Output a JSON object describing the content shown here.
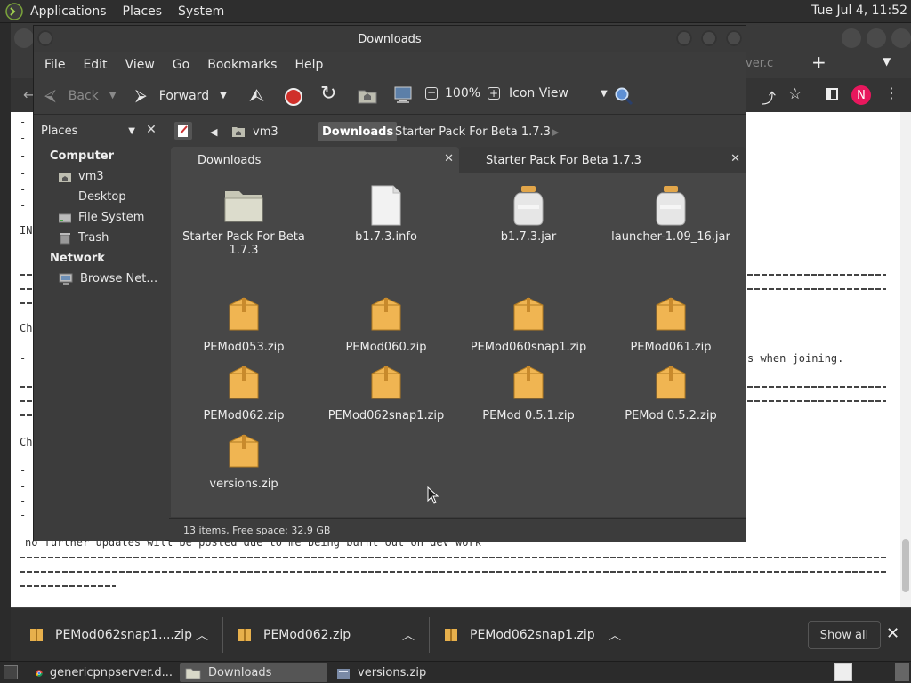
{
  "top_panel": {
    "menus": [
      "Applications",
      "Places",
      "System"
    ],
    "clock": "Tue Jul  4, 11:52"
  },
  "browser": {
    "background_lines": [
      "no further updates will be posted due to me being burnt out on dev work",
      "s when joining."
    ],
    "background_fragments": [
      "IN",
      "Ch",
      "Ch",
      "ver.c"
    ],
    "avatar_letter": "N",
    "accent": "#e8175d"
  },
  "downloads_bar": {
    "items": [
      "PEMod062snap1....zip",
      "PEMod062.zip",
      "PEMod062snap1.zip"
    ],
    "show_all": "Show all"
  },
  "taskbar": {
    "items": [
      "genericpnpserver.d...",
      "Downloads",
      "versions.zip"
    ]
  },
  "fm": {
    "title": "Downloads",
    "menus": [
      "File",
      "Edit",
      "View",
      "Go",
      "Bookmarks",
      "Help"
    ],
    "toolbar": {
      "back": "Back",
      "forward": "Forward",
      "zoom": "100%",
      "view_mode": "Icon View"
    },
    "sidebar": {
      "selector": "Places",
      "computer_header": "Computer",
      "computer_items": [
        "vm3",
        "Desktop",
        "File System",
        "Trash"
      ],
      "network_header": "Network",
      "network_items": [
        "Browse Net…"
      ]
    },
    "path": [
      "vm3",
      "Downloads",
      "Starter Pack For Beta 1.7.3"
    ],
    "tabs": [
      "Downloads",
      "Starter Pack For Beta 1.7.3"
    ],
    "files": [
      {
        "name": "Starter Pack For Beta 1.7.3",
        "kind": "folder"
      },
      {
        "name": "b1.7.3.info",
        "kind": "document"
      },
      {
        "name": "b1.7.3.jar",
        "kind": "jar"
      },
      {
        "name": "launcher-1.09_16.jar",
        "kind": "jar"
      },
      {
        "name": "PEMod053.zip",
        "kind": "archive"
      },
      {
        "name": "PEMod060.zip",
        "kind": "archive"
      },
      {
        "name": "PEMod060snap1.zip",
        "kind": "archive"
      },
      {
        "name": "PEMod061.zip",
        "kind": "archive"
      },
      {
        "name": "PEMod062.zip",
        "kind": "archive"
      },
      {
        "name": "PEMod062snap1.zip",
        "kind": "archive"
      },
      {
        "name": "PEMod 0.5.1.zip",
        "kind": "archive"
      },
      {
        "name": "PEMod 0.5.2.zip",
        "kind": "archive"
      },
      {
        "name": "versions.zip",
        "kind": "archive"
      }
    ],
    "status": "13 items, Free space: 32.9 GB"
  }
}
